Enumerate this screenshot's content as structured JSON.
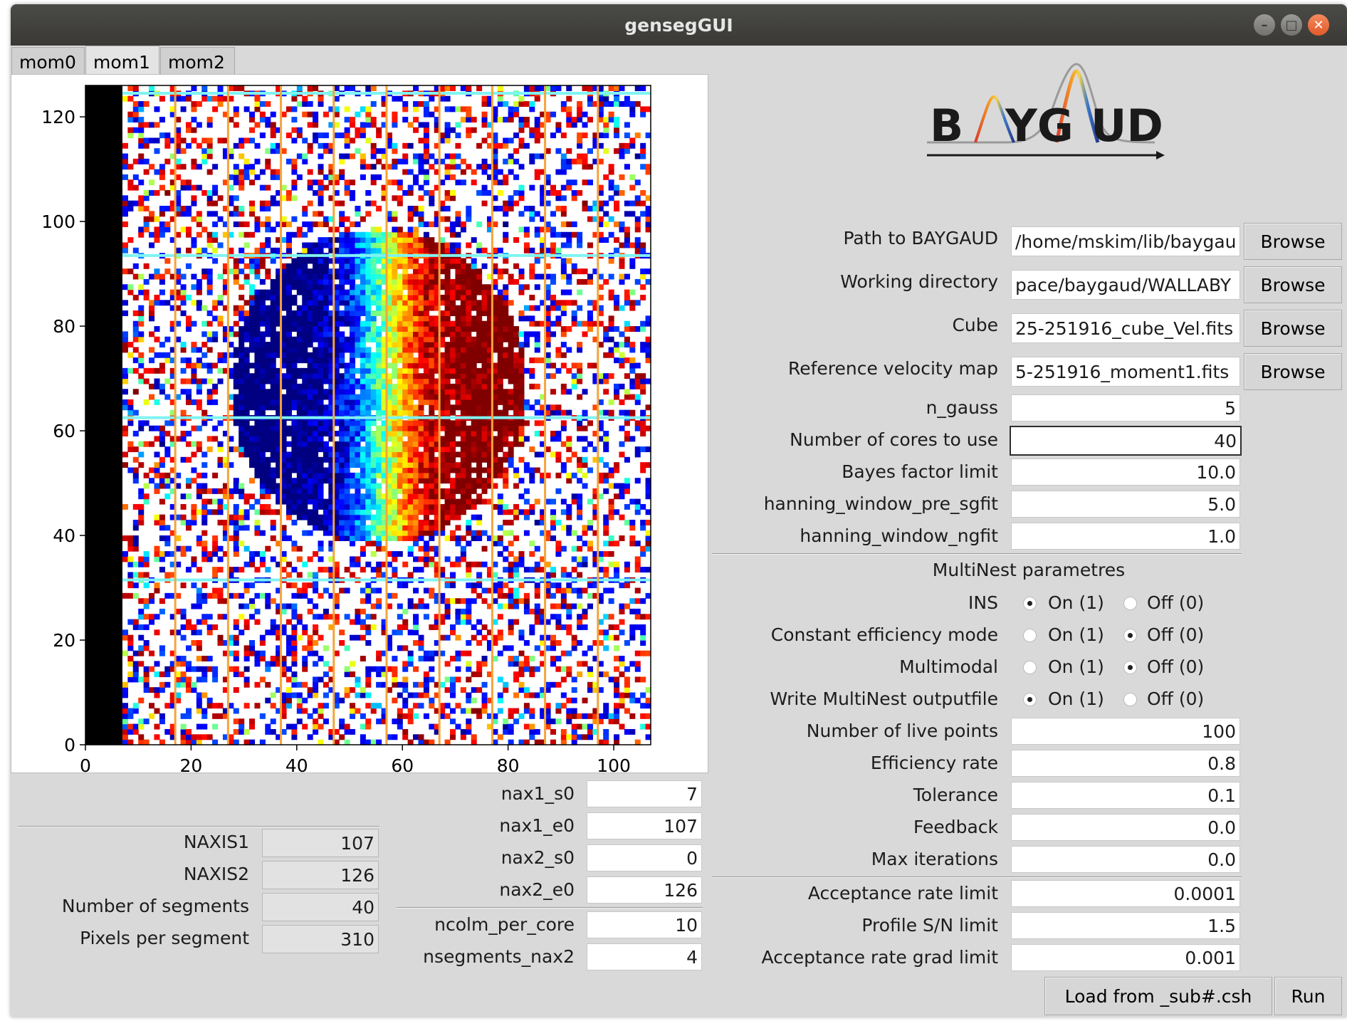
{
  "window": {
    "title": "gensegGUI",
    "buttons": [
      "minimize-icon",
      "maximize-icon",
      "close-icon"
    ]
  },
  "tabs": [
    {
      "label": "mom0",
      "active": false
    },
    {
      "label": "mom1",
      "active": true
    },
    {
      "label": "mom2",
      "active": false
    }
  ],
  "logo": {
    "text": "BAYGAUD",
    "left": "B",
    "mid": "YG",
    "right": "UD"
  },
  "plot": {
    "x_ticks": [
      "0",
      "20",
      "40",
      "60",
      "80",
      "100"
    ],
    "y_ticks": [
      "0",
      "20",
      "40",
      "60",
      "80",
      "100",
      "120"
    ],
    "xlim": [
      0,
      107
    ],
    "ylim": [
      0,
      126
    ],
    "vertical_lines_x": [
      17,
      27,
      37,
      47,
      57,
      67,
      77,
      87,
      97
    ],
    "horizontal_lines_y": [
      31.5,
      62.5,
      93.5,
      124.5
    ],
    "masked_columns": [
      0,
      7
    ],
    "line_colors": {
      "vertical": "#f5a43a",
      "horizontal": "#7ff3f3"
    }
  },
  "paths": [
    {
      "label": "Path to BAYGAUD",
      "value": "/home/mskim/lib/baygau",
      "button": "Browse"
    },
    {
      "label": "Working directory",
      "value": "pace/baygaud/WALLABY",
      "button": "Browse"
    },
    {
      "label": "Cube",
      "value": "25-251916_cube_Vel.fits",
      "button": "Browse"
    },
    {
      "label": "Reference velocity map",
      "value": "5-251916_moment1.fits",
      "button": "Browse"
    }
  ],
  "params": [
    {
      "label": "n_gauss",
      "value": "5"
    },
    {
      "label": "Number of cores to use",
      "value": "40"
    },
    {
      "label": "Bayes factor limit",
      "value": "10.0"
    },
    {
      "label": "hanning_window_pre_sgfit",
      "value": "5.0"
    },
    {
      "label": "hanning_window_ngfit",
      "value": "1.0"
    }
  ],
  "multinest": {
    "title": "MultiNest parametres",
    "radios": [
      {
        "label": "INS",
        "on": "On (1)",
        "off": "Off (0)",
        "selected": "on"
      },
      {
        "label": "Constant efficiency mode",
        "on": "On (1)",
        "off": "Off (0)",
        "selected": "off"
      },
      {
        "label": "Multimodal",
        "on": "On (1)",
        "off": "Off (0)",
        "selected": "off"
      },
      {
        "label": "Write MultiNest outputfile",
        "on": "On (1)",
        "off": "Off (0)",
        "selected": "on"
      }
    ],
    "fields": [
      {
        "label": "Number of live points",
        "value": "100"
      },
      {
        "label": "Efficiency rate",
        "value": "0.8"
      },
      {
        "label": "Tolerance",
        "value": "0.1"
      },
      {
        "label": "Feedback",
        "value": "0.0"
      },
      {
        "label": "Max iterations",
        "value": "0.0"
      }
    ]
  },
  "limits": [
    {
      "label": "Acceptance rate limit",
      "value": "0.0001"
    },
    {
      "label": "Profile S/N limit",
      "value": "1.5"
    },
    {
      "label": "Acceptance rate grad limit",
      "value": "0.001"
    }
  ],
  "naxis": [
    {
      "label": "NAXIS1",
      "value": "107"
    },
    {
      "label": "NAXIS2",
      "value": "126"
    },
    {
      "label": "Number of segments",
      "value": "40"
    },
    {
      "label": "Pixels per segment",
      "value": "310"
    }
  ],
  "ranges": [
    {
      "label": "nax1_s0",
      "value": "7"
    },
    {
      "label": "nax1_e0",
      "value": "107"
    },
    {
      "label": "nax2_s0",
      "value": "0"
    },
    {
      "label": "nax2_e0",
      "value": "126"
    }
  ],
  "cores": [
    {
      "label": "ncolm_per_core",
      "value": "10"
    },
    {
      "label": "nsegments_nax2",
      "value": "4"
    }
  ],
  "actions": {
    "load": "Load from _sub#.csh",
    "run": "Run"
  }
}
